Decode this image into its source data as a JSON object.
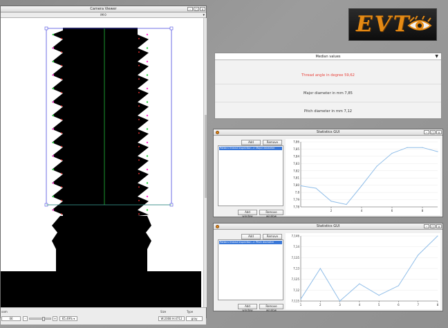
{
  "camera_viewer": {
    "title": "Camera Viewer",
    "subtitle": "IM 0",
    "bottom": {
      "label_left": "oom",
      "zoom_value": "06",
      "zoom_percent": "65.49%",
      "size_label": "Size",
      "type_label": "Type",
      "size_value": "W:2008 H:4712",
      "type_value": "gray"
    }
  },
  "logo": {
    "text": "EVT"
  },
  "median": {
    "header": "Median values",
    "rows": [
      {
        "text": "Thread angle in degree 59,62",
        "color": "#e8413a"
      },
      {
        "text": "Major diameter in mm 7,85",
        "color": "#333333"
      },
      {
        "text": "Pitch diameter in mm 7,12",
        "color": "#333333"
      }
    ]
  },
  "stats1": {
    "title": "Statistics GUI",
    "add_label": "Add",
    "remove_label": "Remove",
    "list_item": "Pattern thread inspection -> Major diameter",
    "add_window_label": "Add window",
    "remove_window_label": "Remove window"
  },
  "stats2": {
    "title": "Statistics GUI",
    "add_label": "Add",
    "remove_label": "Remove",
    "list_item": "Pattern thread inspection -> Pitch diameter",
    "add_window_label": "Add window",
    "remove_window_label": "Remove window"
  },
  "chart_data": [
    {
      "type": "line",
      "x": [
        0,
        1,
        2,
        3,
        4,
        5,
        6,
        7,
        8,
        9
      ],
      "values": [
        7.806,
        7.803,
        7.787,
        7.783,
        7.806,
        7.83,
        7.846,
        7.853,
        7.853,
        7.848
      ],
      "xticks": [
        2,
        4,
        6,
        8
      ],
      "xlim": [
        0,
        9
      ],
      "ylim": [
        7.78,
        7.86
      ],
      "yticks": [
        "7,86",
        "7,85",
        "7,84",
        "7,83",
        "7,82",
        "7,81",
        "7,80",
        "7,8",
        "7,79",
        "7,78"
      ],
      "line_color": "#8fbde8"
    },
    {
      "type": "line",
      "x": [
        1,
        2,
        3,
        4,
        5,
        6,
        7,
        8
      ],
      "values": [
        7.115,
        7.131,
        7.114,
        7.123,
        7.117,
        7.122,
        7.138,
        7.148
      ],
      "xticks": [
        1,
        2,
        3,
        4,
        5,
        6,
        7,
        8
      ],
      "xlim": [
        1,
        8
      ],
      "ylim": [
        7.114,
        7.148
      ],
      "yticks": [
        "7,146",
        "7,14",
        "7,135",
        "7,13",
        "7,125",
        "7,12",
        "7,115"
      ],
      "line_color": "#8fbde8"
    }
  ]
}
